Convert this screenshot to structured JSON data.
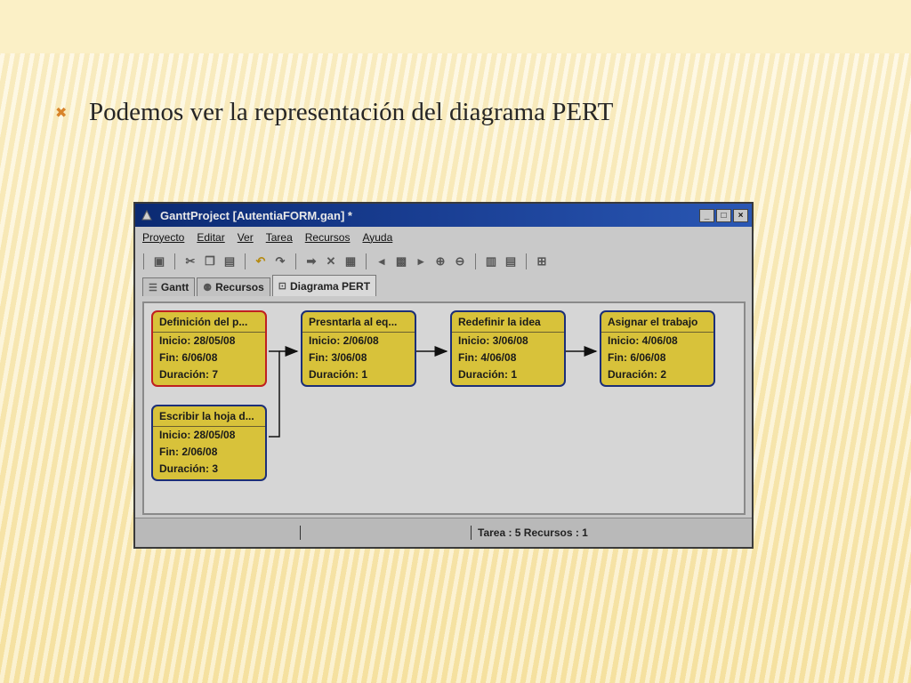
{
  "slide": {
    "bullet_text": "Podemos ver la representación del diagrama PERT"
  },
  "window": {
    "title": "GanttProject [AutentiaFORM.gan] *",
    "buttons": {
      "minimize": "_",
      "maximize": "□",
      "close": "×"
    }
  },
  "menu": [
    "Proyecto",
    "Editar",
    "Ver",
    "Tarea",
    "Recursos",
    "Ayuda"
  ],
  "tabs": [
    {
      "label": "Gantt",
      "icon": "gantt-icon"
    },
    {
      "label": "Recursos",
      "icon": "resources-icon"
    },
    {
      "label": "Diagrama PERT",
      "icon": "pert-icon",
      "selected": true
    }
  ],
  "nodes": [
    {
      "title": "Definición del p...",
      "start": "Inicio: 28/05/08",
      "end": "Fin: 6/06/08",
      "duration": "Duración: 7",
      "critical": true
    },
    {
      "title": "Escribir la hoja d...",
      "start": "Inicio: 28/05/08",
      "end": "Fin: 2/06/08",
      "duration": "Duración: 3",
      "critical": false
    },
    {
      "title": "Presntarla al eq...",
      "start": "Inicio: 2/06/08",
      "end": "Fin: 3/06/08",
      "duration": "Duración: 1",
      "critical": false
    },
    {
      "title": "Redefinir la idea",
      "start": "Inicio: 3/06/08",
      "end": "Fin: 4/06/08",
      "duration": "Duración: 1",
      "critical": false
    },
    {
      "title": "Asignar el trabajo",
      "start": "Inicio: 4/06/08",
      "end": "Fin: 6/06/08",
      "duration": "Duración: 2",
      "critical": false
    }
  ],
  "status": {
    "summary": "Tarea : 5  Recursos : 1"
  },
  "colors": {
    "node_fill": "#d8c23a",
    "node_border": "#1c2f78",
    "critical_border": "#c02020",
    "bullet": "#d8842a"
  }
}
